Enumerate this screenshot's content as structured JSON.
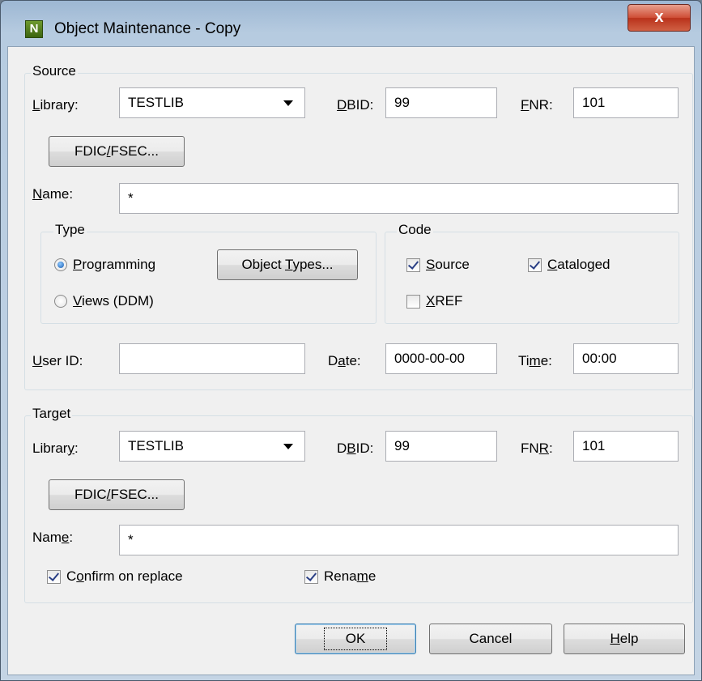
{
  "window": {
    "title": "Object Maintenance - Copy",
    "icon_letter": "N",
    "close_glyph": "x"
  },
  "source": {
    "legend": "Source",
    "library_label": "Library:",
    "library_value": "TESTLIB",
    "dbid_label": "DBID:",
    "dbid_value": "99",
    "fnr_label": "FNR:",
    "fnr_value": "101",
    "fdic_button": "FDIC/FSEC...",
    "name_label": "Name:",
    "name_value": "*",
    "userid_label": "User ID:",
    "userid_value": "",
    "date_label": "Date:",
    "date_value": "0000-00-00",
    "time_label": "Time:",
    "time_value": "00:00"
  },
  "type": {
    "legend": "Type",
    "programming_label": "Programming",
    "programming_selected": true,
    "views_label": "Views (DDM)",
    "views_selected": false,
    "object_types_button": "Object Types..."
  },
  "code": {
    "legend": "Code",
    "source_label": "Source",
    "source_checked": true,
    "cataloged_label": "Cataloged",
    "cataloged_checked": true,
    "xref_label": "XREF",
    "xref_checked": false
  },
  "target": {
    "legend": "Target",
    "library_label": "Library:",
    "library_value": "TESTLIB",
    "dbid_label": "DBID:",
    "dbid_value": "99",
    "fnr_label": "FNR:",
    "fnr_value": "101",
    "fdic_button": "FDIC/FSEC...",
    "name_label": "Name:",
    "name_value": "*",
    "confirm_label": "Confirm on replace",
    "confirm_checked": true,
    "rename_label": "Rename",
    "rename_checked": true
  },
  "buttons": {
    "ok": "OK",
    "cancel": "Cancel",
    "help": "Help"
  }
}
